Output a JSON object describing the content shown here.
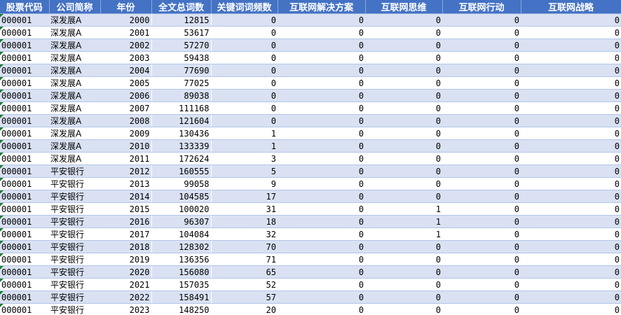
{
  "colors": {
    "header_bg": "#4472c4",
    "header_text": "#ffffff",
    "band_row": "#d9e1f2",
    "plain_row": "#ffffff",
    "text_flag": "#1e7b34"
  },
  "columns": [
    "股票代码",
    "公司简称",
    "年份",
    "全文总词数",
    "关键词词频数",
    "互联网解决方案",
    "互联网思维",
    "互联网行动",
    "互联网战略"
  ],
  "rows": [
    [
      "000001",
      "深发展A",
      "2000",
      "12815",
      "0",
      "0",
      "0",
      "0",
      "0"
    ],
    [
      "000001",
      "深发展A",
      "2001",
      "53617",
      "0",
      "0",
      "0",
      "0",
      "0"
    ],
    [
      "000001",
      "深发展A",
      "2002",
      "57270",
      "0",
      "0",
      "0",
      "0",
      "0"
    ],
    [
      "000001",
      "深发展A",
      "2003",
      "59438",
      "0",
      "0",
      "0",
      "0",
      "0"
    ],
    [
      "000001",
      "深发展A",
      "2004",
      "77690",
      "0",
      "0",
      "0",
      "0",
      "0"
    ],
    [
      "000001",
      "深发展A",
      "2005",
      "77025",
      "0",
      "0",
      "0",
      "0",
      "0"
    ],
    [
      "000001",
      "深发展A",
      "2006",
      "89038",
      "0",
      "0",
      "0",
      "0",
      "0"
    ],
    [
      "000001",
      "深发展A",
      "2007",
      "111168",
      "0",
      "0",
      "0",
      "0",
      "0"
    ],
    [
      "000001",
      "深发展A",
      "2008",
      "121604",
      "0",
      "0",
      "0",
      "0",
      "0"
    ],
    [
      "000001",
      "深发展A",
      "2009",
      "130436",
      "1",
      "0",
      "0",
      "0",
      "0"
    ],
    [
      "000001",
      "深发展A",
      "2010",
      "133339",
      "1",
      "0",
      "0",
      "0",
      "0"
    ],
    [
      "000001",
      "深发展A",
      "2011",
      "172624",
      "3",
      "0",
      "0",
      "0",
      "0"
    ],
    [
      "000001",
      "平安银行",
      "2012",
      "160555",
      "5",
      "0",
      "0",
      "0",
      "0"
    ],
    [
      "000001",
      "平安银行",
      "2013",
      "99058",
      "9",
      "0",
      "0",
      "0",
      "0"
    ],
    [
      "000001",
      "平安银行",
      "2014",
      "104585",
      "17",
      "0",
      "0",
      "0",
      "0"
    ],
    [
      "000001",
      "平安银行",
      "2015",
      "100020",
      "31",
      "0",
      "1",
      "0",
      "0"
    ],
    [
      "000001",
      "平安银行",
      "2016",
      "96307",
      "18",
      "0",
      "1",
      "0",
      "0"
    ],
    [
      "000001",
      "平安银行",
      "2017",
      "104084",
      "32",
      "0",
      "1",
      "0",
      "0"
    ],
    [
      "000001",
      "平安银行",
      "2018",
      "128302",
      "70",
      "0",
      "0",
      "0",
      "0"
    ],
    [
      "000001",
      "平安银行",
      "2019",
      "136356",
      "71",
      "0",
      "0",
      "0",
      "0"
    ],
    [
      "000001",
      "平安银行",
      "2020",
      "156080",
      "65",
      "0",
      "0",
      "0",
      "0"
    ],
    [
      "000001",
      "平安银行",
      "2021",
      "157035",
      "52",
      "0",
      "0",
      "0",
      "0"
    ],
    [
      "000001",
      "平安银行",
      "2022",
      "158491",
      "57",
      "0",
      "0",
      "0",
      "0"
    ],
    [
      "000001",
      "平安银行",
      "2023",
      "148250",
      "20",
      "0",
      "0",
      "0",
      "0"
    ]
  ]
}
